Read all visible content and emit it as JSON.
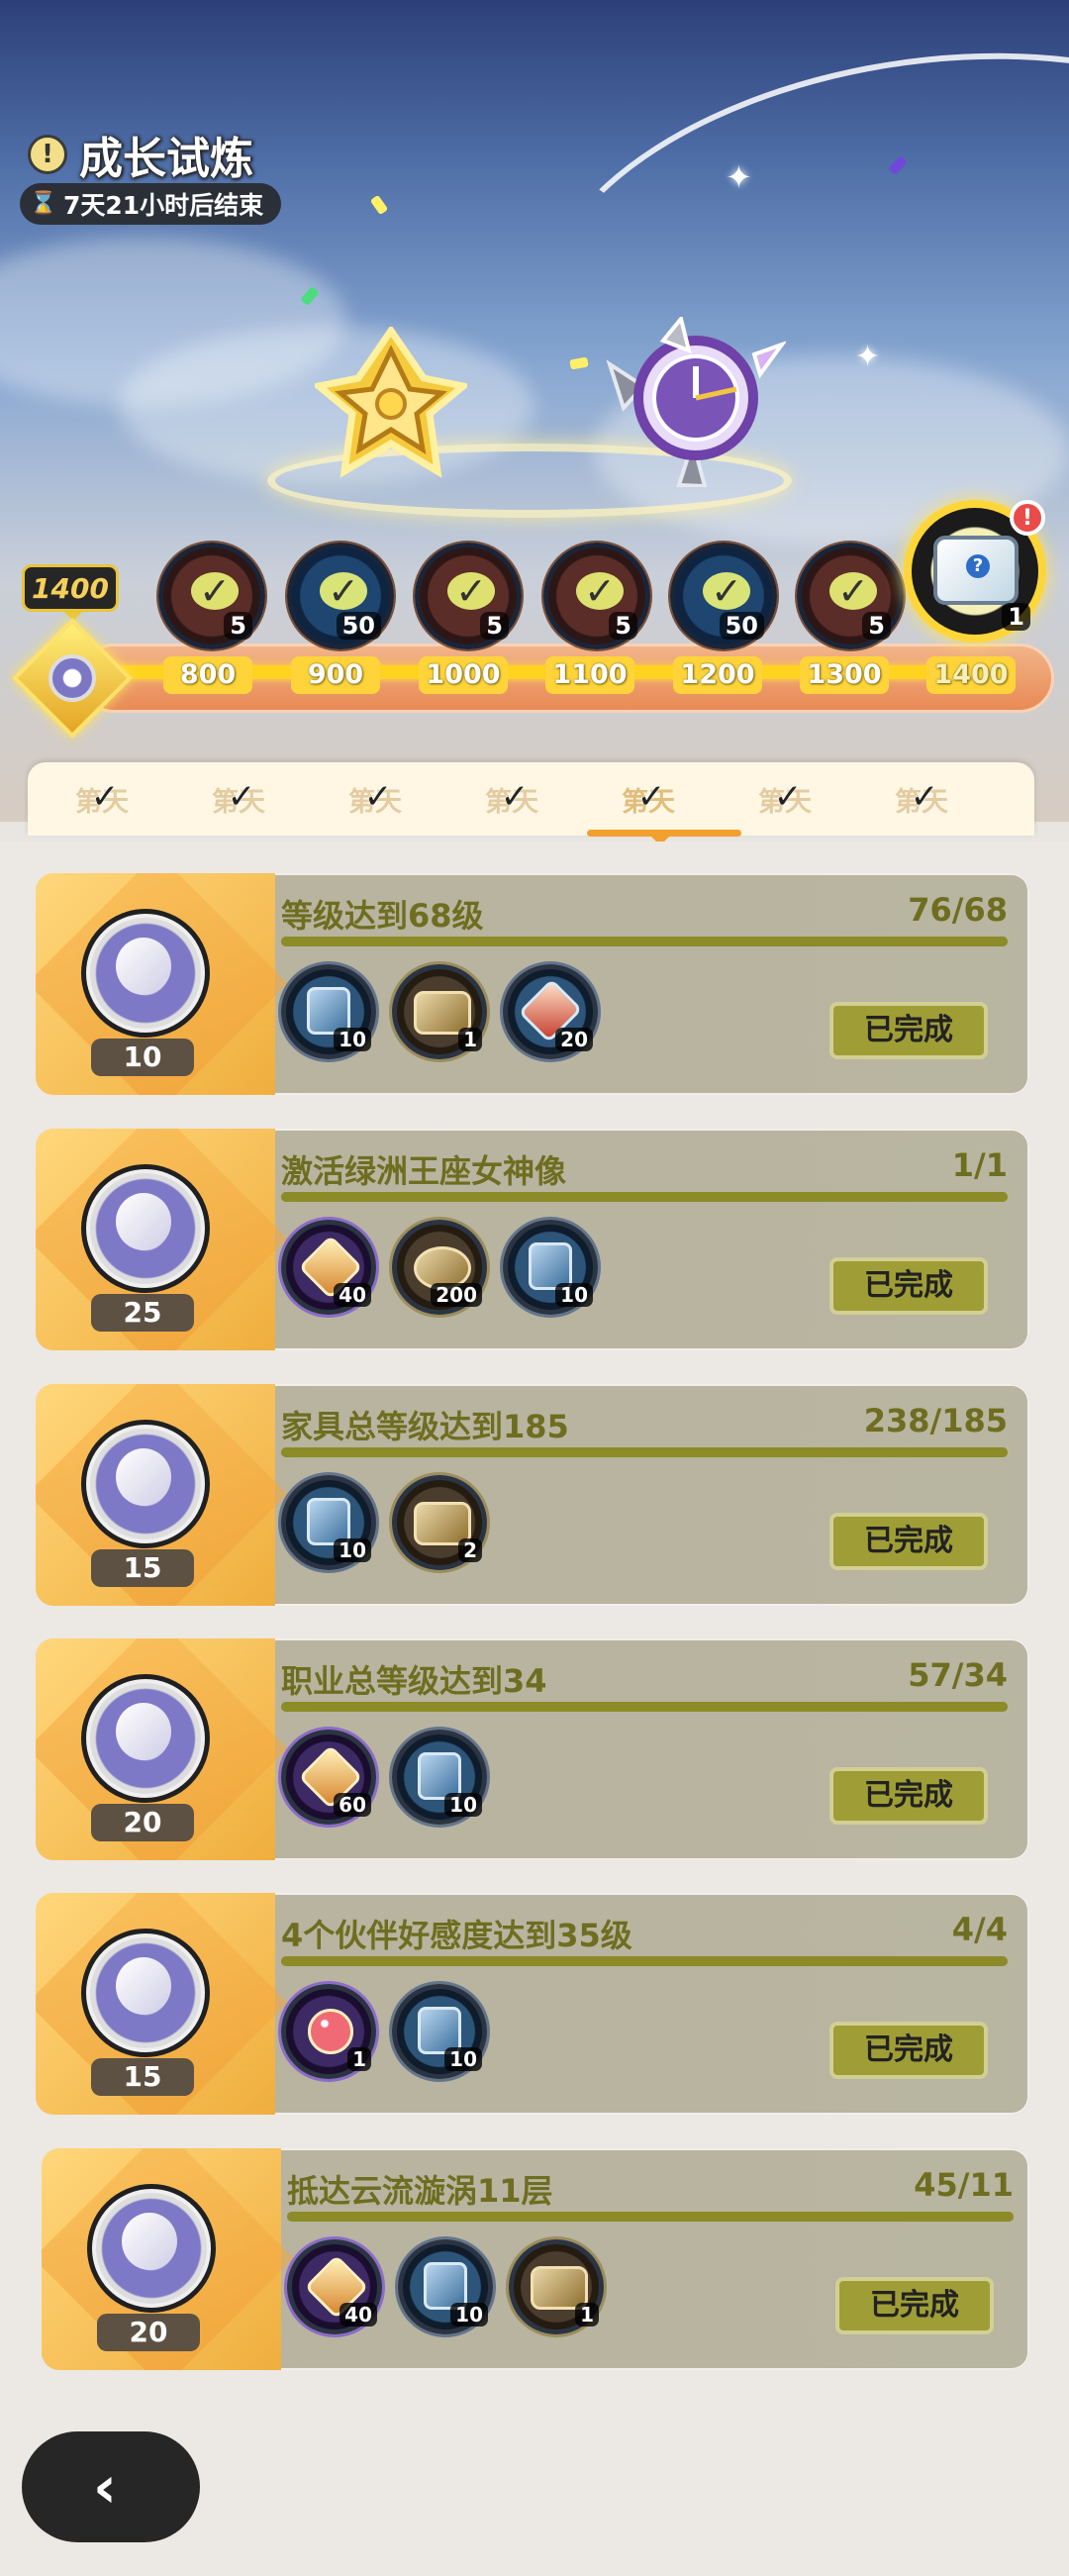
{
  "header": {
    "title": "成长试炼",
    "timer": "7天21小时后结束"
  },
  "track": {
    "current_points": "1400",
    "milestones": [
      {
        "points": "800",
        "count": "5",
        "style": "red"
      },
      {
        "points": "900",
        "count": "50",
        "style": "blue"
      },
      {
        "points": "1000",
        "count": "5",
        "style": "red"
      },
      {
        "points": "1100",
        "count": "5",
        "style": "red"
      },
      {
        "points": "1200",
        "count": "50",
        "style": "blue"
      },
      {
        "points": "1300",
        "count": "5",
        "style": "red"
      }
    ],
    "final_reward": {
      "points": "1400",
      "count": "1"
    }
  },
  "tabs": {
    "labels": [
      "第天",
      "第天",
      "第天",
      "第天",
      "第天",
      "第天",
      "第天"
    ],
    "active_index": 4
  },
  "tasks": [
    {
      "title": "等级达到68级",
      "progress": "76/68",
      "reward": "10",
      "status": "已完成",
      "items": [
        {
          "qty": "10",
          "type": "blue"
        },
        {
          "qty": "1",
          "type": "gold"
        },
        {
          "qty": "20",
          "type": "blue-crystal"
        }
      ]
    },
    {
      "title": "激活绿洲王座女神像",
      "progress": "1/1",
      "reward": "25",
      "status": "已完成",
      "items": [
        {
          "qty": "40",
          "type": "purple"
        },
        {
          "qty": "200",
          "type": "gold"
        },
        {
          "qty": "10",
          "type": "blue"
        }
      ]
    },
    {
      "title": "家具总等级达到185",
      "progress": "238/185",
      "reward": "15",
      "status": "已完成",
      "items": [
        {
          "qty": "10",
          "type": "blue"
        },
        {
          "qty": "2",
          "type": "gold"
        }
      ]
    },
    {
      "title": "职业总等级达到34",
      "progress": "57/34",
      "reward": "20",
      "status": "已完成",
      "items": [
        {
          "qty": "60",
          "type": "purple"
        },
        {
          "qty": "10",
          "type": "blue"
        }
      ]
    },
    {
      "title": "4个伙伴好感度达到35级",
      "progress": "4/4",
      "reward": "15",
      "status": "已完成",
      "items": [
        {
          "qty": "1",
          "type": "purple"
        },
        {
          "qty": "10",
          "type": "blue"
        }
      ]
    },
    {
      "title": "抵达云流漩涡11层",
      "progress": "45/11",
      "reward": "20",
      "status": "已完成",
      "items": [
        {
          "qty": "40",
          "type": "purple"
        },
        {
          "qty": "10",
          "type": "blue"
        },
        {
          "qty": "1",
          "type": "gold"
        }
      ]
    }
  ]
}
